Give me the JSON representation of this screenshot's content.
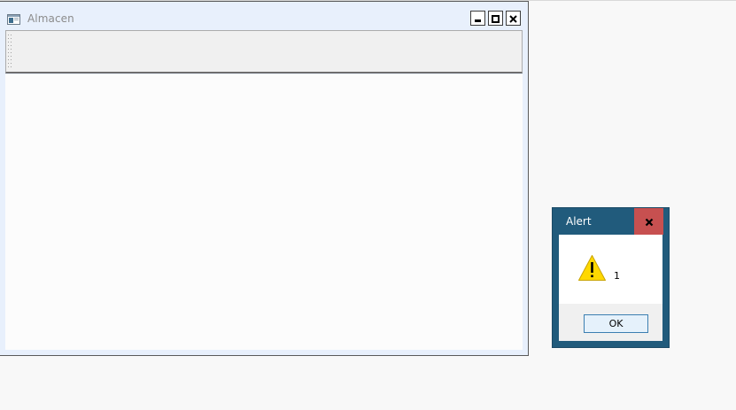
{
  "main_window": {
    "title": "Almacen",
    "icon": "window-app-icon",
    "controls": {
      "minimize": "minimize-icon",
      "maximize": "maximize-icon",
      "close": "close-icon"
    }
  },
  "alert": {
    "title": "Alert",
    "message": "1",
    "ok_label": "OK",
    "icon": "warning-icon"
  },
  "colors": {
    "dialog_frame": "#215b7c",
    "dialog_close": "#c75050",
    "window_frame": "#e8f0fc",
    "ok_button_border": "#3c7fb1"
  }
}
